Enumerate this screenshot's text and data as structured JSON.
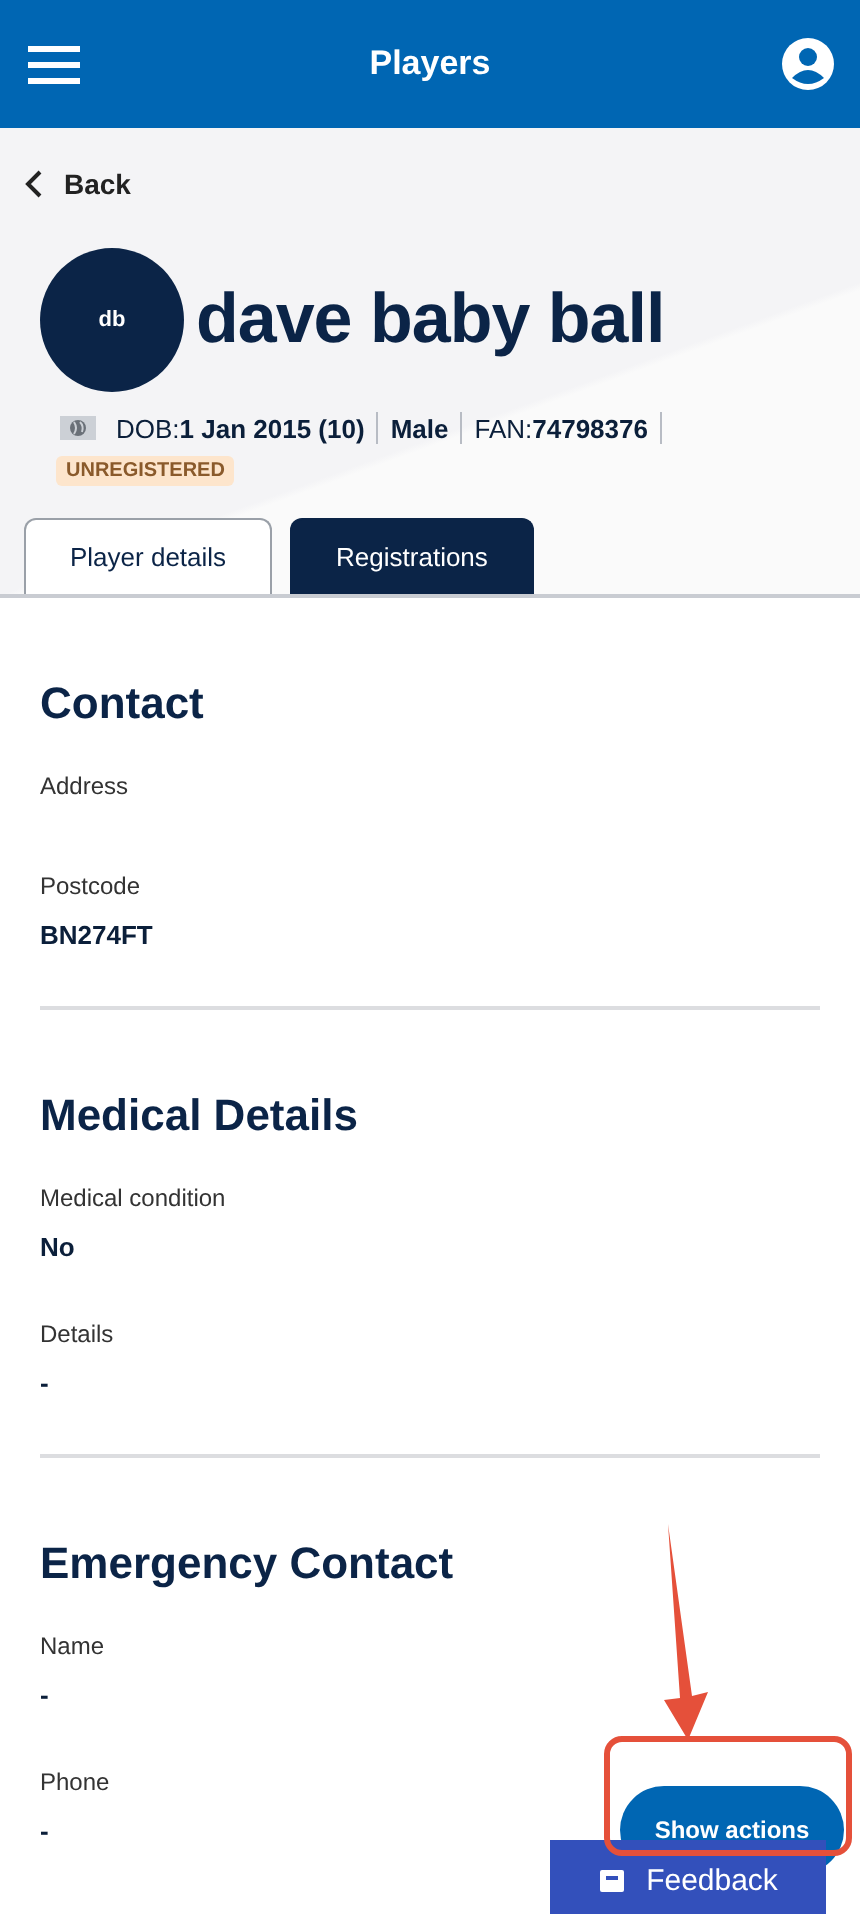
{
  "header": {
    "title": "Players"
  },
  "back": {
    "label": "Back"
  },
  "player": {
    "initials": "db",
    "name": "dave baby ball",
    "meta": [
      {
        "label": "DOB:",
        "value": "1 Jan 2015 (10)"
      },
      {
        "value": "Male"
      },
      {
        "label": "FAN:",
        "value": "74798376"
      }
    ],
    "status": "UNREGISTERED"
  },
  "tabs": [
    {
      "label": "Player details",
      "selected": true
    },
    {
      "label": "Registrations",
      "selected": false
    }
  ],
  "sections": [
    {
      "title": "Contact",
      "fields": [
        {
          "label": "Address"
        },
        {
          "label": "Postcode",
          "value": "BN274FT"
        }
      ]
    },
    {
      "title": "Medical Details",
      "fields": [
        {
          "label": "Medical condition",
          "value": "No"
        },
        {
          "label": "Details",
          "value": "-"
        }
      ]
    },
    {
      "title": "Emergency Contact",
      "fields": [
        {
          "label": "Name",
          "value": "-"
        },
        {
          "label": "Phone",
          "value": "-"
        }
      ]
    }
  ],
  "actions_button": "Show actions",
  "feedback_button": "Feedback"
}
